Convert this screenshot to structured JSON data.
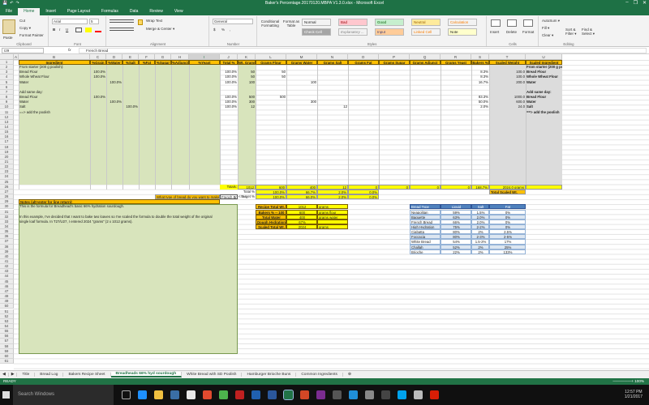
{
  "window": {
    "title": "Baker's Percentage.20170120.MBPA V1.3.0.xlsx - Microsoft Excel",
    "qat": [
      "💾",
      "↶",
      "↷"
    ],
    "controls": [
      "–",
      "❐",
      "✕"
    ]
  },
  "ribbon_tabs": [
    "File",
    "Home",
    "Insert",
    "Page Layout",
    "Formulas",
    "Data",
    "Review",
    "View"
  ],
  "clipboard": {
    "cut": "Cut",
    "copy": "Copy ▾",
    "format_painter": "Format Painter",
    "paste": "Paste",
    "label": "Clipboard"
  },
  "font": {
    "name": "Arial",
    "size": "5",
    "label": "Font",
    "bold": "B",
    "italic": "I",
    "underline": "U"
  },
  "alignment": {
    "wrap": "Wrap Text",
    "merge": "Merge & Center ▾",
    "label": "Alignment"
  },
  "number": {
    "format": "General",
    "label": "Number",
    "pct": "%",
    "comma": ",",
    "dollar": "$"
  },
  "styles": {
    "label": "Styles",
    "conditional": "Conditional Formatting",
    "format_table": "Format as Table",
    "gallery": [
      {
        "name": "Normal",
        "bg": "#ffffff",
        "fg": "#000000"
      },
      {
        "name": "Bad",
        "bg": "#ffc7ce",
        "fg": "#9c0006"
      },
      {
        "name": "Good",
        "bg": "#c6efce",
        "fg": "#006100"
      },
      {
        "name": "Neutral",
        "bg": "#ffeb9c",
        "fg": "#9c6500"
      },
      {
        "name": "Calculation",
        "bg": "#f2f2f2",
        "fg": "#fa7d00"
      },
      {
        "name": "Check Cell",
        "bg": "#a5a5a5",
        "fg": "#ffffff"
      },
      {
        "name": "Explanatory ...",
        "bg": "#ffffff",
        "fg": "#7f7f7f"
      },
      {
        "name": "Input",
        "bg": "#ffcc99",
        "fg": "#3f3f76"
      },
      {
        "name": "Linked Cell",
        "bg": "#ffffff",
        "fg": "#fa7d00"
      },
      {
        "name": "Note",
        "bg": "#ffffcc",
        "fg": "#000000"
      }
    ]
  },
  "cells": {
    "label": "Cells",
    "insert": "Insert",
    "delete": "Delete",
    "format": "Format"
  },
  "editing": {
    "label": "Editing",
    "autosum": "AutoSum ▾",
    "fill": "Fill ▾",
    "clear": "Clear ▾",
    "sort": "Sort & Filter ▾",
    "find": "Find & Select ▾"
  },
  "formula_bar": {
    "name_box": "I29",
    "fx": "fx",
    "content": "French Bread"
  },
  "columns": [
    "A",
    "B",
    "C",
    "D",
    "E",
    "F",
    "G",
    "H",
    "I",
    "J",
    "K",
    "L",
    "M",
    "N",
    "O",
    "P",
    "Q",
    "R",
    "S",
    "T",
    "U"
  ],
  "selected_column": "I",
  "rows": [
    "1",
    "2",
    "3",
    "4",
    "5",
    "6",
    "7",
    "8",
    "9",
    "10",
    "11",
    "12",
    "13",
    "14",
    "15",
    "16",
    "17",
    "18",
    "19",
    "20",
    "21",
    "22",
    "23",
    "24",
    "25",
    "26",
    "27",
    "28",
    "29",
    "30",
    "31",
    "32",
    "33",
    "34",
    "35",
    "36",
    "37",
    "38",
    "39",
    "40",
    "41",
    "42",
    "43",
    "44",
    "45",
    "46",
    "47",
    "48",
    "49",
    "50",
    "51",
    "52",
    "53",
    "54",
    "55",
    "56",
    "57",
    "58",
    "59",
    "60",
    "61"
  ],
  "headers": [
    "Ingredient",
    "%Grain",
    "%Water",
    "%Salt",
    "%Fat",
    "%Sugar",
    "%Adjunct",
    "%Yeast",
    "Total %",
    "Wt. Grams",
    "Grams Flour",
    "Grams Water",
    "Grams Salt",
    "Grams Fat",
    "Grams Sugar",
    "Grams Adjunct",
    "Grams Yeast",
    "Bakers %",
    "Scaled Weight",
    "Scaled Ingredient"
  ],
  "sheet_rows": [
    [
      "From starter (200 g poolish):",
      "",
      "",
      "",
      "",
      "",
      "",
      "",
      "",
      "",
      "",
      "",
      "",
      "",
      "",
      "",
      "",
      "",
      "",
      "From starter (200 g poolish):"
    ],
    [
      "Bread Flour",
      "100.0%",
      "",
      "",
      "",
      "",
      "",
      "",
      "100.0%",
      "50",
      "50",
      "",
      "",
      "",
      "",
      "",
      "",
      "8.3%",
      "100.0",
      "Bread Flour"
    ],
    [
      "Whole Wheat Flour",
      "100.0%",
      "",
      "",
      "",
      "",
      "",
      "",
      "100.0%",
      "50",
      "50",
      "",
      "",
      "",
      "",
      "",
      "",
      "8.3%",
      "100.0",
      "Whole Wheat Flour"
    ],
    [
      "Water",
      "",
      "100.0%",
      "",
      "",
      "",
      "",
      "",
      "100.0%",
      "100",
      "",
      "100",
      "",
      "",
      "",
      "",
      "",
      "16.7%",
      "200.0",
      "Water"
    ],
    [
      "",
      "",
      "",
      "",
      "",
      "",
      "",
      "",
      "",
      "",
      "",
      "",
      "",
      "",
      "",
      "",
      "",
      "",
      "",
      ""
    ],
    [
      "Add same day:",
      "",
      "",
      "",
      "",
      "",
      "",
      "",
      "",
      "",
      "",
      "",
      "",
      "",
      "",
      "",
      "",
      "",
      "",
      "Add same day:"
    ],
    [
      "Bread Flour",
      "100.0%",
      "",
      "",
      "",
      "",
      "",
      "",
      "100.0%",
      "500",
      "500",
      "",
      "",
      "",
      "",
      "",
      "",
      "83.3%",
      "1000.0",
      "Bread Flour"
    ],
    [
      "Water",
      "",
      "100.0%",
      "",
      "",
      "",
      "",
      "",
      "100.0%",
      "300",
      "",
      "300",
      "",
      "",
      "",
      "",
      "",
      "50.0%",
      "600.0",
      "Water"
    ],
    [
      "Salt",
      "",
      "",
      "100.0%",
      "",
      "",
      "",
      "",
      "100.0%",
      "12",
      "",
      "",
      "12",
      "",
      "",
      "",
      "",
      "2.0%",
      "24.0",
      "Salt"
    ],
    [
      "==> add the poolish",
      "",
      "",
      "",
      "",
      "",
      "",
      "",
      "",
      "",
      "",
      "",
      "",
      "",
      "",
      "",
      "",
      "",
      "",
      "==> add the poolish"
    ]
  ],
  "totals": {
    "label": "Totals:",
    "wt": "1012",
    "flour": "600",
    "water": "400",
    "salt": "12",
    "fat": "0",
    "sugar": "0",
    "adjunct": "0",
    "yeast": "0",
    "bakers": "168.7%",
    "scaled": "2024.0 grams",
    "scaled_label": "Total Scaled Wt."
  },
  "total_pct": {
    "label": "Total %",
    "k": "100.0%",
    "water": "66.7%",
    "salt": "2.0%",
    "fat": "0.0%"
  },
  "target_pct": {
    "label": "Target %",
    "k": "100.0%",
    "water": "66.0%",
    "salt": "2.0%",
    "fat": "0.0%"
  },
  "question": {
    "text": "What type of bread do you want to make?",
    "value": "French Bread",
    "arrow": "<==="
  },
  "notes": {
    "title": "Notes (alt+enter for line return):",
    "lines": [
      "This is the formula for Breadhead's basic 66% hydration sourdough.",
      "",
      "In this example, I've decided that I want to bake two loaves so I've scaled the formula to double the total weight of the original",
      "single loaf formula. In T27/U27, I entered 2024 \"grams\" (2 x 1012 grams)."
    ]
  },
  "recipe": [
    [
      "Recipe Total Wt.",
      "1012",
      "grams"
    ],
    [
      "Bakers % -- 100",
      "600",
      "grams flour"
    ],
    [
      "Total Water",
      "400",
      "grams water"
    ],
    [
      "Dough Hydration",
      "67%",
      ""
    ],
    [
      "Scaled Total Wt.",
      "2024",
      "grams"
    ]
  ],
  "bread_table": {
    "headers": [
      "Bread Type",
      "Liquid",
      "Salt",
      "Fat"
    ],
    "rows": [
      [
        "Neapolitan",
        "59%",
        "1.5%",
        "0%"
      ],
      [
        "Baguette",
        "63%",
        "2.0%",
        "0%"
      ],
      [
        "French Bread",
        "66%",
        "2.0%",
        "0%"
      ],
      [
        "High Hydration",
        "75%",
        "2-2%",
        "0%"
      ],
      [
        "Ciabatta",
        "80%",
        "2%",
        "2.5%"
      ],
      [
        "Foccacia",
        "80%",
        "2-3%",
        "2-5%"
      ],
      [
        "White Bread",
        "54%",
        "1.5-2%",
        "17%"
      ],
      [
        "Challah",
        "52%",
        "2%",
        "25%"
      ],
      [
        "Brioche",
        "22%",
        "2%",
        "133%"
      ]
    ]
  },
  "sheet_tabs": [
    "Title",
    "Bread Log",
    "Bakers Recipe Sheet",
    "Breadheads 66% hyd sourdough",
    "White Bread with SD Poolish",
    "Hamburger Brioche Buns",
    "Common Ingredients"
  ],
  "active_sheet": "Breadheads 66% hyd sourdough",
  "status": {
    "left": "READY",
    "zoom": "—————+ 100%"
  },
  "taskbar": {
    "search": "Search Windows",
    "time": "12:57 PM",
    "date": "1/21/2017"
  },
  "colors": {
    "excel_green": "#217346",
    "header_orange": "#ffc000",
    "input_green": "#d8e4bc",
    "total_yellow": "#ffff00",
    "table_blue": "#4f81bd"
  }
}
